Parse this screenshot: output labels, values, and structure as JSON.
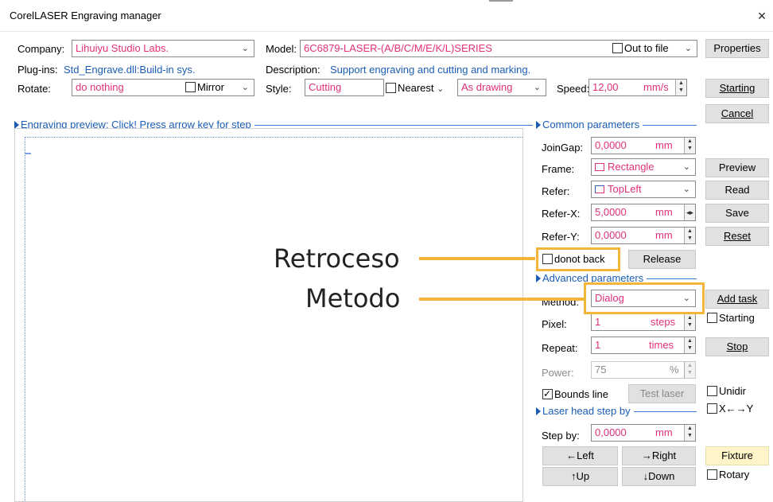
{
  "window": {
    "title": "CorelLASER Engraving manager",
    "close": "×"
  },
  "top": {
    "company_label": "Company:",
    "company_value": "Lihuiyu Studio Labs.",
    "model_label": "Model:",
    "model_value": "6C6879-LASER-(A/B/C/M/E/K/L)SERIES",
    "out_to_file": "Out to file",
    "properties": "Properties",
    "plugins_label": "Plug-ins:",
    "plugins_value": "Std_Engrave.dll:Build-in sys.",
    "description_label": "Description:",
    "description_value": "Support engraving and cutting and marking.",
    "rotate_label": "Rotate:",
    "rotate_value": "do nothing",
    "mirror": "Mirror",
    "style_label": "Style:",
    "style_value": "Cutting",
    "nearest": "Nearest",
    "drawing_value": "As drawing",
    "speed_label": "Speed:",
    "speed_value": "12,00",
    "speed_unit": "mm/s",
    "starting": "Starting",
    "cancel": "Cancel"
  },
  "preview": {
    "title": "Engraving preview: Click! Press arrow key for step"
  },
  "common": {
    "title": "Common parameters",
    "joingap_label": "JoinGap:",
    "joingap_value": "0,0000",
    "joingap_unit": "mm",
    "frame_label": "Frame:",
    "frame_value": "Rectangle",
    "refer_label": "Refer:",
    "refer_value": "TopLeft",
    "referx_label": "Refer-X:",
    "referx_value": "5,0000",
    "referx_unit": "mm",
    "refery_label": "Refer-Y:",
    "refery_value": "0,0000",
    "refery_unit": "mm",
    "donot_back": "donot back",
    "release": "Release"
  },
  "side_buttons": {
    "preview": "Preview",
    "read": "Read",
    "save": "Save",
    "reset": "Reset",
    "add_task": "Add task",
    "starting_cb": "Starting",
    "stop": "Stop",
    "unidir": "Unidir",
    "xy": "X←→Y",
    "fixture": "Fixture",
    "rotary": "Rotary"
  },
  "advanced": {
    "title": "Advanced parameters",
    "method_label": "Method:",
    "method_value": "Dialog",
    "pixel_label": "Pixel:",
    "pixel_value": "1",
    "pixel_unit": "steps",
    "repeat_label": "Repeat:",
    "repeat_value": "1",
    "repeat_unit": "times",
    "power_label": "Power:",
    "power_value": "75",
    "power_unit": "%",
    "bounds_line": "Bounds line",
    "test_laser": "Test laser"
  },
  "laser_head": {
    "title": "Laser head step by",
    "stepby_label": "Step by:",
    "stepby_value": "0,0000",
    "stepby_unit": "mm",
    "left": "←Left",
    "right": "→Right",
    "up": "↑Up",
    "down": "↓Down"
  },
  "callouts": {
    "retroceso": "Retroceso",
    "metodo": "Metodo",
    "color": "#f5b43a"
  }
}
